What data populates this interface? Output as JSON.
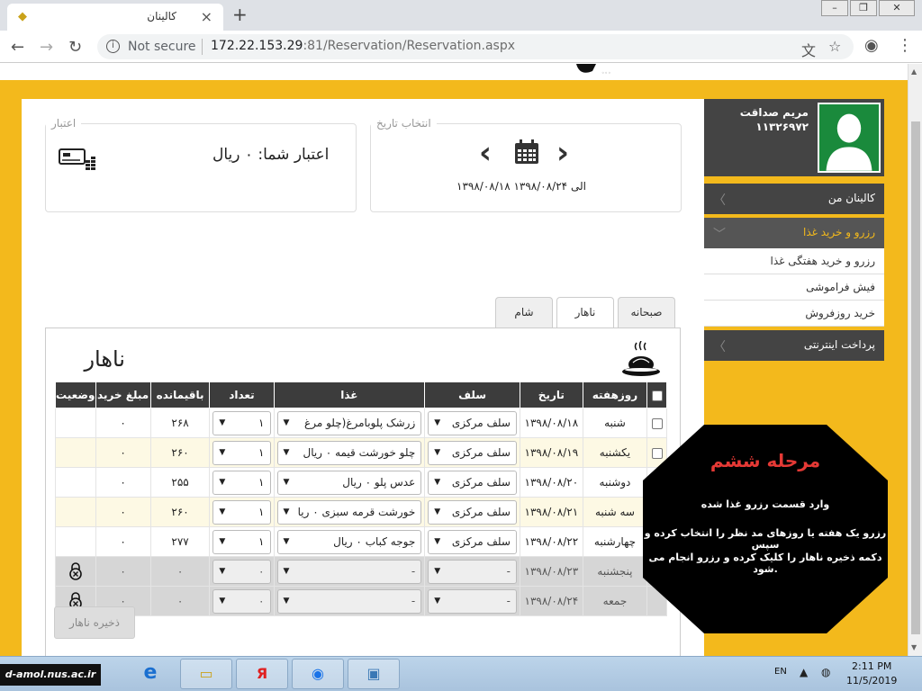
{
  "browser": {
    "tab_title": "کالینان",
    "not_secure": "Not secure",
    "url_host": "172.22.153.29",
    "url_rest": ":81/Reservation/Reservation.aspx"
  },
  "date_box": {
    "legend": "انتخاب تاریخ",
    "range": "۱۳۹۸/۰۸/۱۸ الی ۱۳۹۸/۰۸/۲۴"
  },
  "credit_box": {
    "legend": "اعتبار",
    "text": "اعتبار شما: ۰ ریال"
  },
  "tabs": [
    {
      "label": "صبحانه",
      "active": false
    },
    {
      "label": "ناهار",
      "active": true
    },
    {
      "label": "شام",
      "active": false
    }
  ],
  "panel_title": "ناهار",
  "table": {
    "headers": [
      "روزهفته",
      "تاریخ",
      "سلف",
      "غذا",
      "تعداد",
      "باقیمانده",
      "مبلغ خرید",
      "وضعیت"
    ],
    "rows": [
      {
        "day": "شنبه",
        "date": "۱۳۹۸/۰۸/۱۸",
        "self": "سلف مرکزی",
        "food": "زرشک پلوبامرغ(چلو مرغ",
        "count": "۱",
        "remaining": "۲۶۸",
        "price": "۰",
        "status": "",
        "disabled": false
      },
      {
        "day": "یکشنبه",
        "date": "۱۳۹۸/۰۸/۱۹",
        "self": "سلف مرکزی",
        "food": "چلو خورشت قیمه ۰ ریال",
        "count": "۱",
        "remaining": "۲۶۰",
        "price": "۰",
        "status": "",
        "disabled": false
      },
      {
        "day": "دوشنبه",
        "date": "۱۳۹۸/۰۸/۲۰",
        "self": "سلف مرکزی",
        "food": "عدس پلو ۰ ریال",
        "count": "۱",
        "remaining": "۲۵۵",
        "price": "۰",
        "status": "",
        "disabled": false
      },
      {
        "day": "سه شنبه",
        "date": "۱۳۹۸/۰۸/۲۱",
        "self": "سلف مرکزی",
        "food": "خورشت قرمه سبزی ۰ ریا",
        "count": "۱",
        "remaining": "۲۶۰",
        "price": "۰",
        "status": "",
        "disabled": false
      },
      {
        "day": "چهارشنبه",
        "date": "۱۳۹۸/۰۸/۲۲",
        "self": "سلف مرکزی",
        "food": "جوجه کباب ۰ ریال",
        "count": "۱",
        "remaining": "۲۷۷",
        "price": "۰",
        "status": "",
        "disabled": false
      },
      {
        "day": "پنجشنبه",
        "date": "۱۳۹۸/۰۸/۲۳",
        "self": "-",
        "food": "-",
        "count": "۰",
        "remaining": "۰",
        "price": "۰",
        "status": "locked",
        "disabled": true
      },
      {
        "day": "جمعه",
        "date": "۱۳۹۸/۰۸/۲۴",
        "self": "-",
        "food": "-",
        "count": "۰",
        "remaining": "۰",
        "price": "۰",
        "status": "locked",
        "disabled": true
      }
    ]
  },
  "save_button": "ذخیره ناهار",
  "profile": {
    "name": "مریم صداقت",
    "id": "۱۱۳۲۶۹۷۲"
  },
  "menu": {
    "items": [
      {
        "label": "کالینان من"
      },
      {
        "label": "رزرو و خرید غذا"
      },
      {
        "label": "پرداخت اینترنتی"
      }
    ],
    "sub_items": [
      {
        "label": "رزرو و خرید هفتگی غذا"
      },
      {
        "label": "فیش فراموشی"
      },
      {
        "label": "خرید روزفروش"
      }
    ]
  },
  "badge": {
    "title": "مرحله ششم",
    "line1": "وارد قسمت رزرو غذا شده",
    "line2": "رزرو یک هفته یا روزهای مد نظر را انتخاب کرده و سپس",
    "line3": "دکمه ذخیره ناهار را کلیک کرده و رزرو انجام می شود."
  },
  "taskbar": {
    "watermark": "d-amol.nus.ac.ir",
    "lang": "EN",
    "time": "2:11 PM",
    "date": "11/5/2019"
  },
  "colors": {
    "page_bg": "#f3b91c",
    "header_dark": "#3c3c3c",
    "badge_title": "#e53935"
  }
}
